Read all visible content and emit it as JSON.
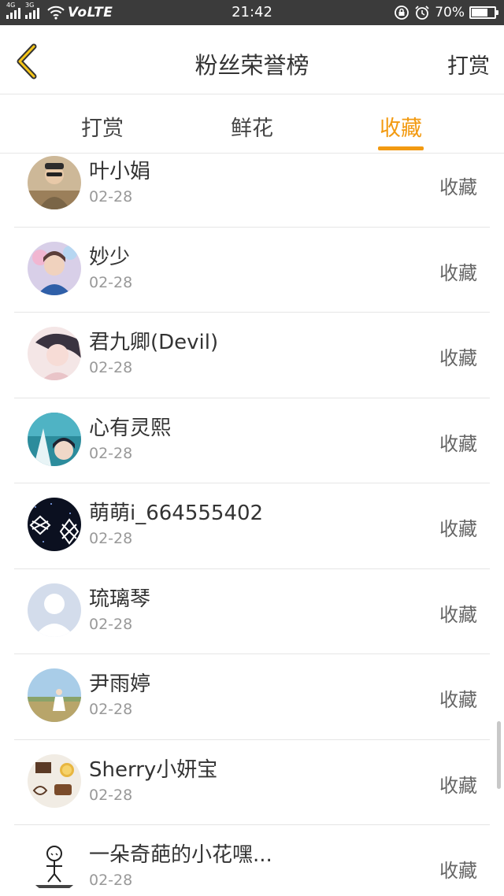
{
  "status_bar": {
    "sig1_tag": "4G",
    "sig2_tag": "3G",
    "network_label": "VoLTE",
    "time": "21:42",
    "battery_text": "70%",
    "battery_level": 0.7
  },
  "header": {
    "title": "粉丝荣誉榜",
    "action_label": "打赏",
    "back_icon": "chevron-left-icon",
    "accent_color": "#f29a11"
  },
  "tabs": [
    {
      "label": "打赏",
      "active": false
    },
    {
      "label": "鲜花",
      "active": false
    },
    {
      "label": "收藏",
      "active": true
    }
  ],
  "list": {
    "items": [
      {
        "name": "叶小娟",
        "date": "02-28",
        "action": "收藏"
      },
      {
        "name": "妙少",
        "date": "02-28",
        "action": "收藏"
      },
      {
        "name": "君九卿(Devil)",
        "date": "02-28",
        "action": "收藏"
      },
      {
        "name": "心有灵熙",
        "date": "02-28",
        "action": "收藏"
      },
      {
        "name": "萌萌i_664555402",
        "date": "02-28",
        "action": "收藏"
      },
      {
        "name": "琉璃琴",
        "date": "02-28",
        "action": "收藏"
      },
      {
        "name": "尹雨婷",
        "date": "02-28",
        "action": "收藏"
      },
      {
        "name": "Sherry小妍宝",
        "date": "02-28",
        "action": "收藏"
      },
      {
        "name": "一朵奇葩的小花嘿...",
        "date": "02-28",
        "action": "收藏"
      }
    ]
  }
}
